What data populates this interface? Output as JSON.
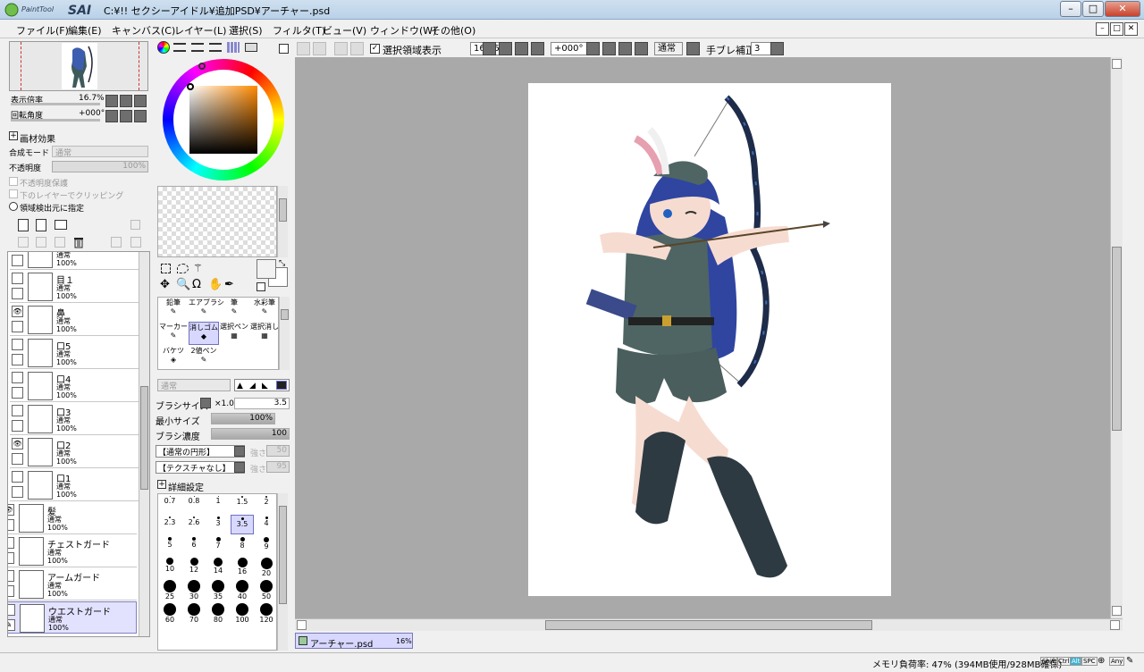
{
  "window": {
    "logo_text": "PaintTool SAI",
    "title": "C:¥!! セクシーアイドル¥追加PSD¥アーチャー.psd"
  },
  "menu": [
    "ファイル(F)",
    "編集(E)",
    "キャンバス(C)",
    "レイヤー(L)",
    "選択(S)",
    "フィルタ(T)",
    "ビュー(V)",
    "ウィンドウ(W)",
    "その他(O)"
  ],
  "navigator": {
    "zoom_label": "表示倍率",
    "zoom_value": "16.7%",
    "rotation_label": "回転角度",
    "rotation_value": "+000°"
  },
  "layer_panel": {
    "effects_label": "画材効果",
    "blend_label": "合成モード",
    "blend_value": "通常",
    "opacity_label": "不透明度",
    "opacity_value": "100%",
    "preserve_opacity": "不透明度保護",
    "clipping": "下のレイヤーでクリッピング",
    "selection_source": "領域検出元に指定",
    "layers": [
      {
        "name": "",
        "mode": "通常",
        "opacity": "100%",
        "visible": false
      },
      {
        "name": "目１",
        "mode": "通常",
        "opacity": "100%",
        "visible": false
      },
      {
        "name": "鼻",
        "mode": "通常",
        "opacity": "100%",
        "visible": true
      },
      {
        "name": "口5",
        "mode": "通常",
        "opacity": "100%",
        "visible": false
      },
      {
        "name": "口4",
        "mode": "通常",
        "opacity": "100%",
        "visible": false
      },
      {
        "name": "口3",
        "mode": "通常",
        "opacity": "100%",
        "visible": false
      },
      {
        "name": "口2",
        "mode": "通常",
        "opacity": "100%",
        "visible": true
      },
      {
        "name": "口1",
        "mode": "通常",
        "opacity": "100%",
        "visible": false
      },
      {
        "name": "髪",
        "mode": "通常",
        "opacity": "100%",
        "visible": true
      },
      {
        "name": "チェストガード",
        "mode": "通常",
        "opacity": "100%",
        "visible": false
      },
      {
        "name": "アームガード",
        "mode": "通常",
        "opacity": "100%",
        "visible": false
      },
      {
        "name": "ウエストガード",
        "mode": "通常",
        "opacity": "100%",
        "visible": false
      }
    ]
  },
  "tools": {
    "brushes": [
      [
        "鉛筆",
        "エアブラシ",
        "筆",
        "水彩筆"
      ],
      [
        "マーカー",
        "消しゴム",
        "選択ペン",
        "選択消し"
      ],
      [
        "バケツ",
        "2値ペン",
        "",
        ""
      ]
    ],
    "selected_brush": "消しゴム",
    "mode_value": "通常",
    "brush_size_label": "ブラシサイズ",
    "brush_size_mult": "×1.0",
    "brush_size_value": "3.5",
    "min_size_label": "最小サイズ",
    "min_size_value": "100%",
    "density_label": "ブラシ濃度",
    "density_value": "100",
    "shape_value": "【通常の円形】",
    "shape_strength_label": "強さ",
    "shape_strength_value": "50",
    "texture_value": "【テクスチャなし】",
    "texture_strength_label": "強さ",
    "texture_strength_value": "95",
    "details_label": "詳細設定",
    "sizes": [
      "0.7",
      "0.8",
      "1",
      "1.5",
      "2",
      "2.3",
      "2.6",
      "3",
      "3.5",
      "4",
      "5",
      "6",
      "7",
      "8",
      "9",
      "10",
      "12",
      "14",
      "16",
      "20",
      "25",
      "30",
      "35",
      "40",
      "50",
      "60",
      "70",
      "80",
      "100",
      "120"
    ],
    "selected_size": "3.5"
  },
  "canvas_toolbar": {
    "show_selection": "選択領域表示",
    "zoom": "16.66%",
    "rotation": "+000°",
    "blend": "通常",
    "stabilizer_label": "手ブレ補正",
    "stabilizer_value": "3"
  },
  "doc_tab": {
    "name": "アーチャー.psd",
    "zoom": "16%"
  },
  "status": {
    "memory": "メモリ負荷率: 47% (394MB使用/928MB確保)",
    "keys": [
      "Shift",
      "Ctrl",
      "Alt",
      "SPC",
      "Any"
    ]
  }
}
